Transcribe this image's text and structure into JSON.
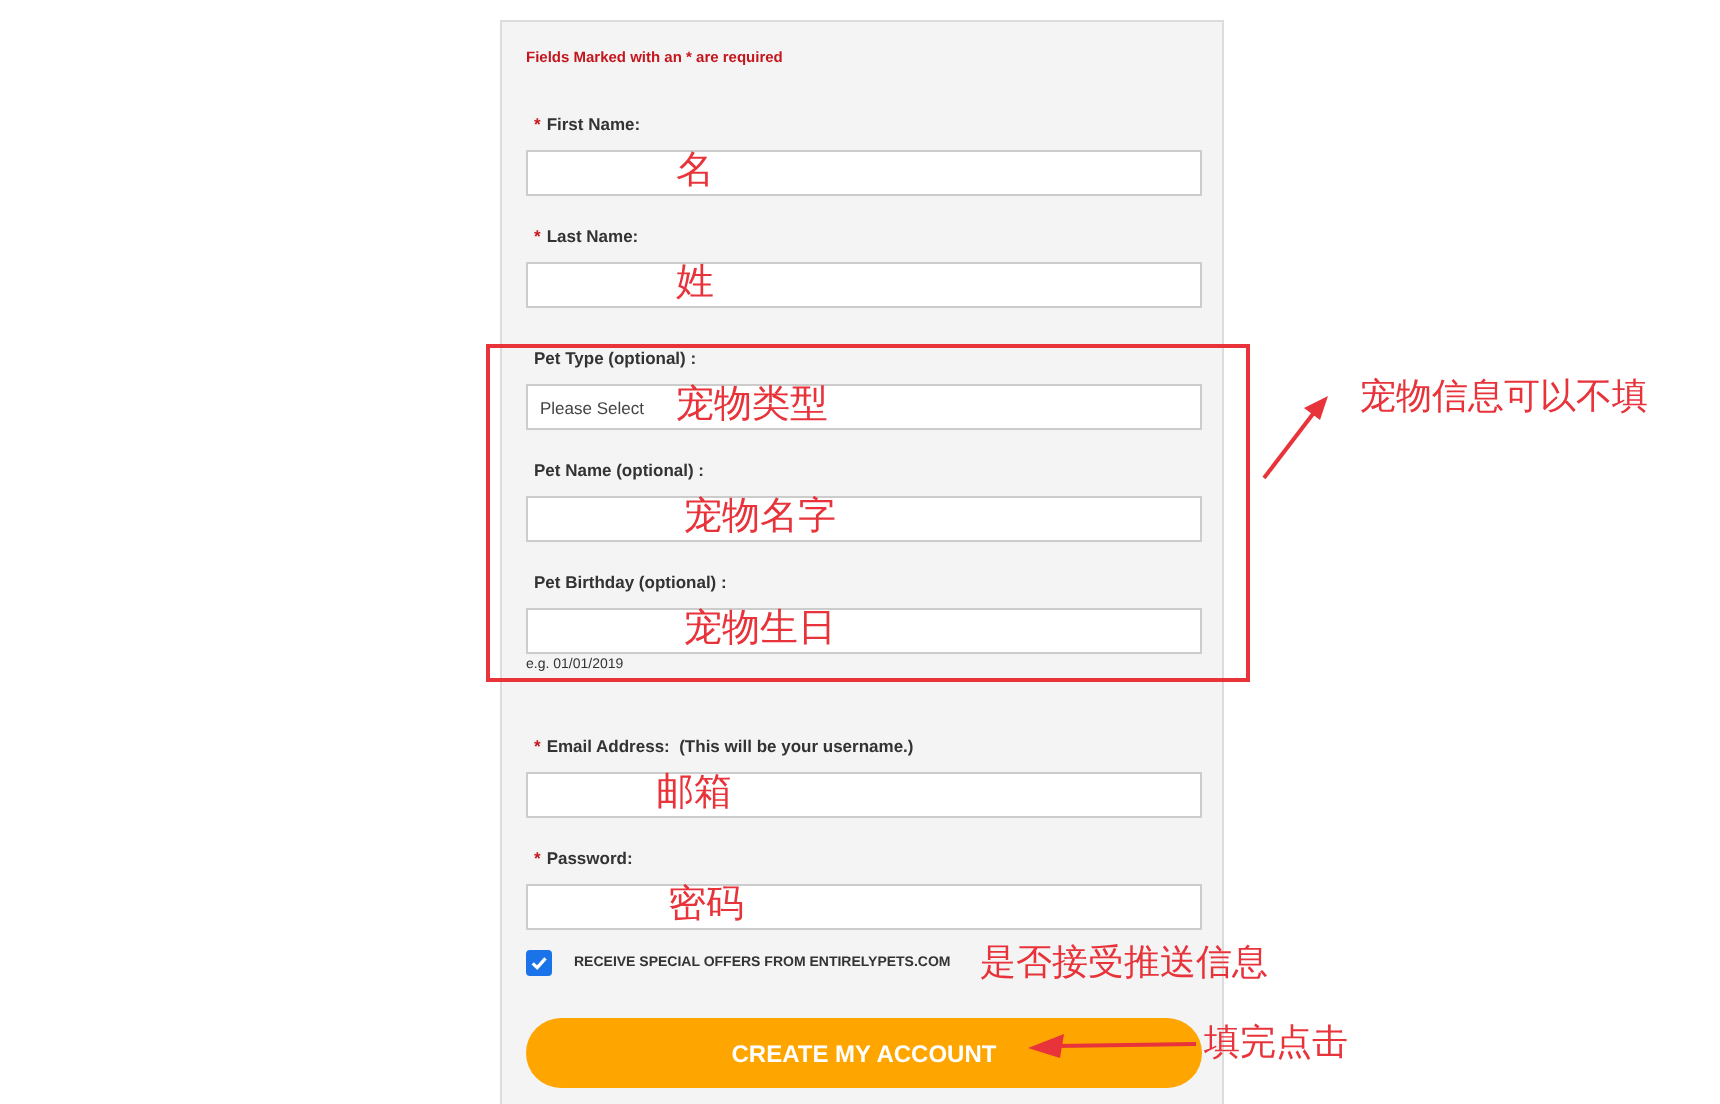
{
  "notice": "Fields Marked with an * are required",
  "fields": [
    {
      "kind": "text",
      "required_mark": "*",
      "label": "First Name:",
      "annotation": "名"
    },
    {
      "kind": "text",
      "required_mark": "*",
      "label": "Last Name:",
      "annotation": "姓"
    },
    {
      "kind": "select",
      "label": "Pet Type (optional) :",
      "value": "Please Select",
      "annotation": "宠物类型"
    },
    {
      "kind": "text",
      "label": "Pet Name (optional) :",
      "annotation": "宠物名字"
    },
    {
      "kind": "text",
      "label": "Pet Birthday (optional) :",
      "hint": "e.g. 01/01/2019",
      "annotation": "宠物生日"
    },
    {
      "kind": "text",
      "required_mark": "*",
      "label": "Email Address:  (This will be your username.)",
      "annotation": "邮箱"
    },
    {
      "kind": "password",
      "required_mark": "*",
      "label": "Password:",
      "annotation": "密码"
    }
  ],
  "offers": {
    "label": "RECEIVE SPECIAL OFFERS FROM ENTIRELYPETS.COM",
    "checked": true,
    "annotation": "是否接受推送信息"
  },
  "submit": {
    "label": "CREATE MY ACCOUNT",
    "annotation": "填完点击"
  },
  "pet_section_note": "宠物信息可以不填"
}
